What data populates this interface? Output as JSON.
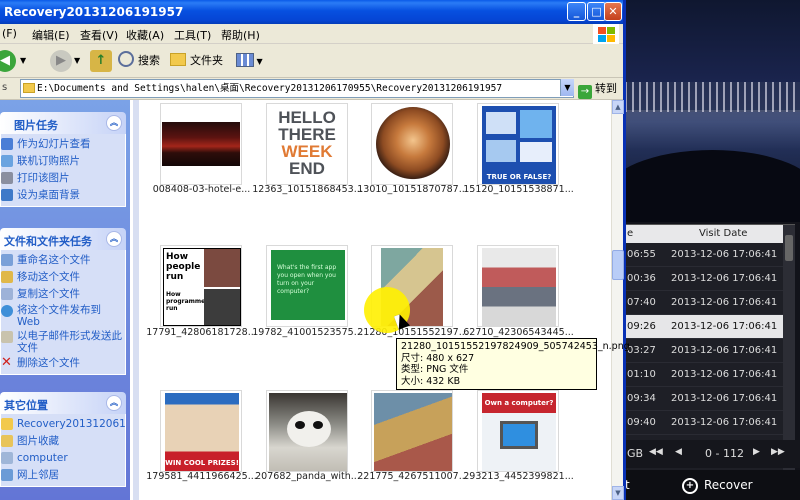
{
  "window": {
    "title": "Recovery20131206191957",
    "min_label": "_",
    "max_label": "□",
    "close_label": "✕"
  },
  "menu": [
    "(F)",
    "编辑(E)",
    "查看(V)",
    "收藏(A)",
    "工具(T)",
    "帮助(H)"
  ],
  "toolbar": {
    "back_label": "",
    "search_label": "搜索",
    "folders_label": "文件夹"
  },
  "address": {
    "path": "E:\\Documents and Settings\\halen\\桌面\\Recovery20131206170955\\Recovery20131206191957",
    "go_label": "转到"
  },
  "panels": {
    "picture_tasks": {
      "title": "图片任务",
      "items": [
        "作为幻灯片查看",
        "联机订购照片",
        "打印该图片",
        "设为桌面背景"
      ]
    },
    "file_tasks": {
      "title": "文件和文件夹任务",
      "items": [
        "重命名这个文件",
        "移动这个文件",
        "复制这个文件",
        "将这个文件发布到 Web",
        "以电子邮件形式发送此文件",
        "删除这个文件"
      ]
    },
    "other_places": {
      "title": "其它位置",
      "items": [
        "Recovery2013120617C",
        "图片收藏",
        "computer",
        "网上邻居"
      ]
    }
  },
  "files": [
    {
      "name": "008408-03-hotel-e..."
    },
    {
      "name": "12363_10151868453..."
    },
    {
      "name": "13010_10151870787..."
    },
    {
      "name": "15120_10151538871..."
    },
    {
      "name": "17791_42806181728..."
    },
    {
      "name": "19782_41001523575..."
    },
    {
      "name": "21280_10151552197..."
    },
    {
      "name": "62710_42306543445..."
    },
    {
      "name": "179581_4411966425..."
    },
    {
      "name": "207682_panda_with..."
    },
    {
      "name": "221775_4267511007..."
    },
    {
      "name": "293213_4452399821..."
    }
  ],
  "thumb_text": {
    "hello": [
      "HELLO",
      "THERE",
      "WEEK",
      "END"
    ],
    "how1": "How people run",
    "how2": "How programmer run",
    "green": "What's the first app you open when you turn on your computer?",
    "fb_true_false": "TRUE OR FALSE?",
    "wincool": "WIN COOL PRIZES!",
    "computer": "Own a computer?"
  },
  "tooltip": {
    "filename": "21280_10151552197824909_505742453_n.png",
    "size": "尺寸: 480 x 627",
    "type": "类型: PNG 文件",
    "filesize": "大小: 432 KB"
  },
  "bgapp": {
    "header_col1": "e",
    "header_col2": "Visit Date",
    "rows": [
      {
        "a": "06:55",
        "b": "2013-12-06 17:06:41"
      },
      {
        "a": "00:36",
        "b": "2013-12-06 17:06:41"
      },
      {
        "a": "07:40",
        "b": "2013-12-06 17:06:41"
      },
      {
        "a": "09:26",
        "b": "2013-12-06 17:06:41"
      },
      {
        "a": "03:27",
        "b": "2013-12-06 17:06:41"
      },
      {
        "a": "01:10",
        "b": "2013-12-06 17:06:41"
      },
      {
        "a": "09:34",
        "b": "2013-12-06 17:06:41"
      },
      {
        "a": "09:40",
        "b": "2013-12-06 17:06:41"
      }
    ],
    "pager_left": "GB",
    "pager_range": "0 - 112",
    "bottom_left": "t",
    "recover_label": "Recover"
  },
  "colors": {
    "titlebar": "#0750e0",
    "taskpane": "#6375d6",
    "link": "#215dc6",
    "tooltip_bg": "#ffffe1"
  }
}
